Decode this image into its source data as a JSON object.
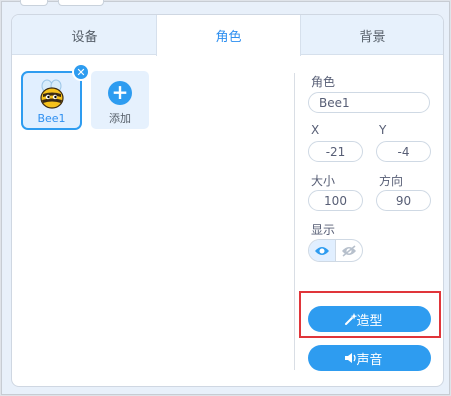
{
  "tabs": [
    {
      "label": "设备"
    },
    {
      "label": "角色"
    },
    {
      "label": "背景"
    }
  ],
  "active_tab": "角色",
  "sprites": [
    {
      "name": "Bee1",
      "selected": true
    }
  ],
  "add_sprite": {
    "label": "添加",
    "icon": "plus-icon"
  },
  "properties": {
    "role_label": "角色",
    "name_value": "Bee1",
    "x_label": "X",
    "x_value": "-21",
    "y_label": "Y",
    "y_value": "-4",
    "size_label": "大小",
    "size_value": "100",
    "direction_label": "方向",
    "direction_value": "90",
    "show_label": "显示"
  },
  "buttons": {
    "costume_label": "造型",
    "sound_label": "声音"
  },
  "colors": {
    "accent": "#2e9cf0",
    "highlight": "#e0353a"
  }
}
